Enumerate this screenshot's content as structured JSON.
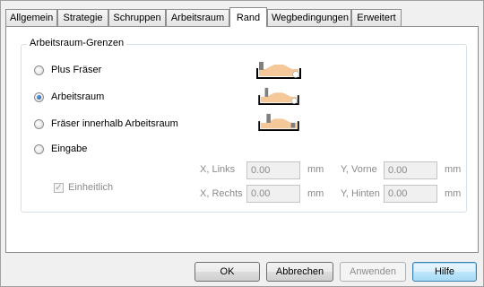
{
  "tabs": [
    {
      "label": "Allgemein",
      "active": false
    },
    {
      "label": "Strategie",
      "active": false
    },
    {
      "label": "Schruppen",
      "active": false
    },
    {
      "label": "Arbeitsraum",
      "active": false
    },
    {
      "label": "Rand",
      "active": true
    },
    {
      "label": "Wegbedingungen",
      "active": false
    },
    {
      "label": "Erweitert",
      "active": false
    }
  ],
  "group": {
    "title": "Arbeitsraum-Grenzen",
    "options": [
      {
        "label": "Plus Fräser",
        "checked": false,
        "icon": "boundary-plus-cutter-icon"
      },
      {
        "label": "Arbeitsraum",
        "checked": true,
        "icon": "boundary-workspace-icon"
      },
      {
        "label": "Fräser innerhalb Arbeitsraum",
        "checked": false,
        "icon": "boundary-cutter-inside-icon"
      },
      {
        "label": "Eingabe",
        "checked": false
      }
    ],
    "uniform": {
      "label": "Einheitlich",
      "checked": true,
      "enabled": false
    },
    "fields": {
      "x_left": {
        "label": "X, Links",
        "value": "0.00",
        "unit": "mm"
      },
      "x_right": {
        "label": "X, Rechts",
        "value": "0.00",
        "unit": "mm"
      },
      "y_front": {
        "label": "Y, Vorne",
        "value": "0.00",
        "unit": "mm"
      },
      "y_back": {
        "label": "Y, Hinten",
        "value": "0.00",
        "unit": "mm"
      }
    }
  },
  "buttons": {
    "ok": "OK",
    "cancel": "Abbrechen",
    "apply": "Anwenden",
    "help": "Hilfe"
  },
  "colors": {
    "material": "#f5c89a",
    "tool": "#7f7f7f",
    "selected_radio": "#1f4f9a"
  }
}
